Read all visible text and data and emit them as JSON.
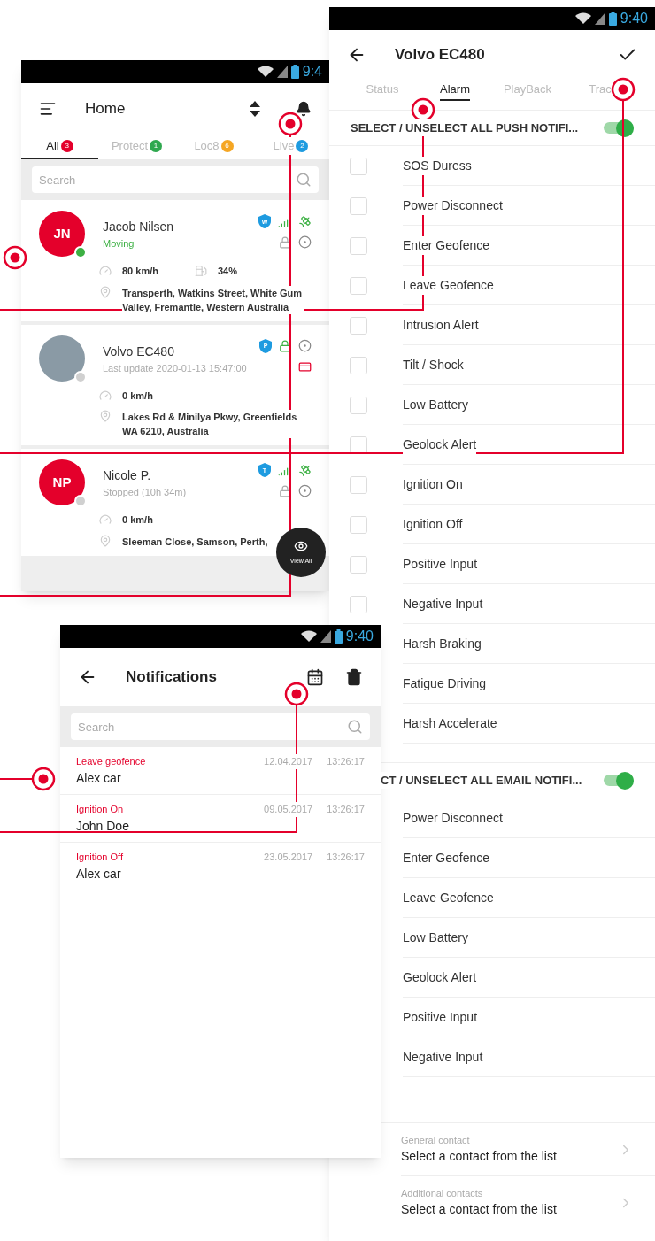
{
  "home": {
    "status_time": "9:4",
    "title": "Home",
    "tabs": [
      {
        "label": "All",
        "count": "3",
        "color": "#e4002b",
        "selected": true
      },
      {
        "label": "Protect",
        "count": "1",
        "color": "#2fa84f",
        "selected": false
      },
      {
        "label": "Loc8",
        "count": "6",
        "color": "#f5a623",
        "selected": false
      },
      {
        "label": "Live",
        "count": "2",
        "color": "#1e9be0",
        "selected": false
      }
    ],
    "search": {
      "placeholder": "Search"
    },
    "vehicles": [
      {
        "kind": "initials",
        "initials": "JN",
        "name": "Jacob Nilsen",
        "status": "Moving",
        "moving": true,
        "color": "#3cb043",
        "shield": "W",
        "icons_top": [
          {
            "kind": "signal"
          },
          {
            "kind": "satellite"
          }
        ],
        "icons_bottom": [
          {
            "kind": "lock",
            "active": false
          },
          {
            "kind": "target"
          }
        ],
        "speed": "80 km/h",
        "fuel": "34%",
        "address": "Transperth, Watkins Street, White Gum Valley, Fremantle, Western Australia"
      },
      {
        "kind": "photo",
        "name": "Volvo EC480",
        "status": "Last update 2020-01-13 15:47:00",
        "moving": false,
        "color": "#d0d0d0",
        "shield": "P",
        "icons_top": [
          {
            "kind": "lock",
            "active": true
          },
          {
            "kind": "target"
          }
        ],
        "icons_bottom": [
          {
            "kind": "card"
          }
        ],
        "speed": "0 km/h",
        "address": "Lakes Rd & Minilya Pkwy, Greenfields WA 6210, Australia"
      },
      {
        "kind": "initials",
        "initials": "NP",
        "name": "Nicole P.",
        "status": "Stopped (10h 34m)",
        "moving": false,
        "color": "#d0d0d0",
        "shield": "T",
        "icons_top": [
          {
            "kind": "signal"
          },
          {
            "kind": "satellite"
          }
        ],
        "icons_bottom": [
          {
            "kind": "lock",
            "active": false
          },
          {
            "kind": "target"
          }
        ],
        "speed": "0 km/h",
        "address": "Sleeman Close, Samson, Perth,"
      }
    ],
    "fab": "View All"
  },
  "alarm": {
    "status_time": "9:40",
    "title": "Volvo EC480",
    "tabs": [
      {
        "label": "Status",
        "selected": false
      },
      {
        "label": "Alarm",
        "selected": true
      },
      {
        "label": "PlayBack",
        "selected": false
      },
      {
        "label": "Trac",
        "selected": false
      }
    ],
    "push": {
      "label": "SELECT / UNSELECT ALL PUSH NOTIFI...",
      "on": true,
      "items": [
        {
          "label": "SOS Duress",
          "checked": false
        },
        {
          "label": "Power Disconnect",
          "checked": false
        },
        {
          "label": "Enter Geofence",
          "checked": false
        },
        {
          "label": "Leave Geofence",
          "checked": false
        },
        {
          "label": "Intrusion Alert",
          "checked": false
        },
        {
          "label": "Tilt / Shock",
          "checked": false
        },
        {
          "label": "Low Battery",
          "checked": false
        },
        {
          "label": "Geolock Alert",
          "checked": false
        },
        {
          "label": "Ignition On",
          "checked": false
        },
        {
          "label": "Ignition Off",
          "checked": false
        },
        {
          "label": "Positive Input",
          "checked": false
        },
        {
          "label": "Negative Input",
          "checked": false
        },
        {
          "label": "Harsh Braking"
        },
        {
          "label": "Fatigue Driving"
        },
        {
          "label": "Harsh Accelerate"
        }
      ]
    },
    "email": {
      "label": "CT / UNSELECT ALL EMAIL NOTIFI...",
      "on": true,
      "items": [
        "Power Disconnect",
        "Enter Geofence",
        "Leave Geofence",
        "Low Battery",
        "Geolock Alert",
        "Positive Input",
        "Negative Input"
      ]
    },
    "contacts": [
      {
        "label": "General contact",
        "value": "Select a contact from the list"
      },
      {
        "label": "Additional contacts",
        "value": "Select a contact from the list"
      }
    ]
  },
  "notifications": {
    "status_time": "9:40",
    "title": "Notifications",
    "search": {
      "placeholder": "Search"
    },
    "items": [
      {
        "event": "Leave geofence",
        "date": "12.04.2017",
        "time": "13:26:17",
        "name": "Alex car"
      },
      {
        "event": "Ignition On",
        "date": "09.05.2017",
        "time": "13:26:17",
        "name": "John Doe"
      },
      {
        "event": "Ignition Off",
        "date": "23.05.2017",
        "time": "13:26:17",
        "name": "Alex car"
      }
    ]
  }
}
